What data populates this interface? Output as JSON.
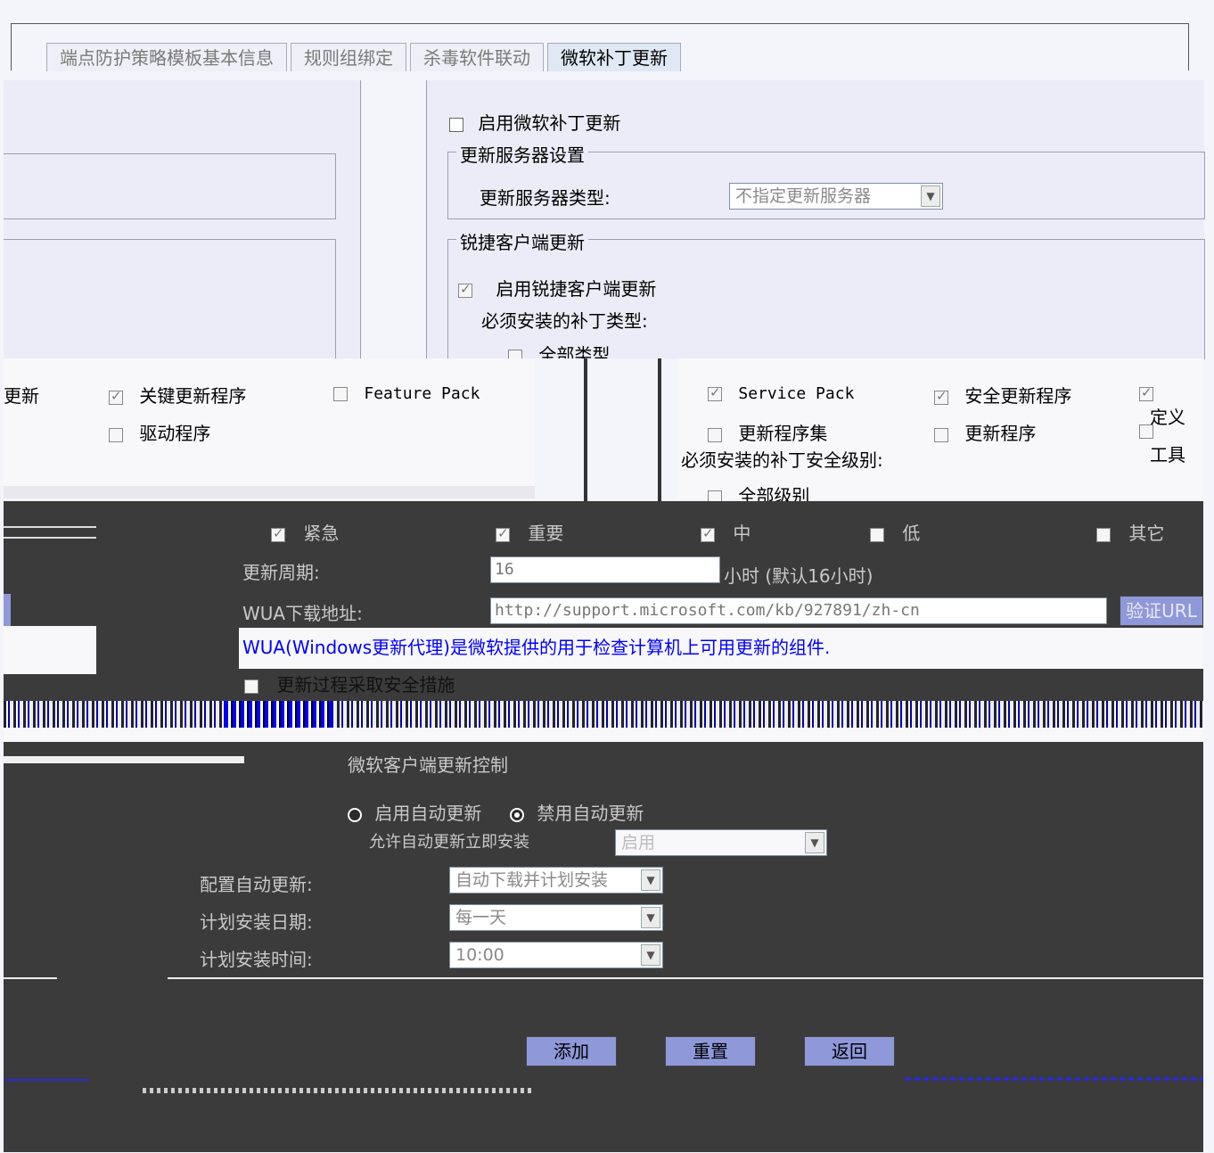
{
  "tabs": [
    {
      "label": "端点防护策略模板基本信息",
      "active": false
    },
    {
      "label": "规则组绑定",
      "active": false
    },
    {
      "label": "杀毒软件联动",
      "active": false
    },
    {
      "label": "微软补丁更新",
      "active": true
    }
  ],
  "enable_ms_patch": {
    "label": "启用微软补丁更新",
    "checked": false
  },
  "server_group": {
    "legend": "更新服务器设置",
    "type_label": "更新服务器类型:",
    "type_value": "不指定更新服务器"
  },
  "ruijie_group": {
    "legend": "锐捷客户端更新",
    "enable_label": "启用锐捷客户端更新",
    "enable_checked": true,
    "patch_types_label": "必须安装的补丁类型:",
    "all_types_label": "全部类型",
    "left_types": [
      {
        "label": "更新",
        "checked": false
      },
      {
        "label": "关键更新程序",
        "checked": true
      },
      {
        "label": "Feature Pack",
        "checked": false
      },
      {
        "label": "驱动程序",
        "checked": false
      }
    ],
    "right_types": [
      {
        "label": "Service Pack",
        "checked": true
      },
      {
        "label": "安全更新程序",
        "checked": true
      },
      {
        "label": "定义",
        "checked": true
      },
      {
        "label": "更新程序集",
        "checked": false
      },
      {
        "label": "更新程序",
        "checked": false
      },
      {
        "label": "工具",
        "checked": false
      }
    ],
    "levels_label": "必须安装的补丁安全级别:",
    "all_levels_label": "全部级别",
    "levels": [
      {
        "label": "紧急",
        "checked": true
      },
      {
        "label": "重要",
        "checked": true
      },
      {
        "label": "中",
        "checked": true
      },
      {
        "label": "低",
        "checked": false
      },
      {
        "label": "其它",
        "checked": false
      }
    ],
    "period_label": "更新周期:",
    "period_value": "16",
    "period_hint": "小时 (默认16小时)",
    "wua_label": "WUA下载地址:",
    "wua_value": "http://support.microsoft.com/kb/927891/zh-cn",
    "verify_label": "验证URL",
    "wua_note": "WUA(Windows更新代理)是微软提供的用于检查计算机上可用更新的组件.",
    "safety_label": "更新过程采取安全措施",
    "safety_checked": false
  },
  "ms_client_group": {
    "legend": "微软客户端更新控制",
    "enable_radio": "启用自动更新",
    "disable_radio": "禁用自动更新",
    "selected": "disable",
    "allow_label": "允许自动更新立即安装",
    "allow_value": "启用",
    "config_label": "配置自动更新:",
    "config_value": "自动下载并计划安装",
    "date_label": "计划安装日期:",
    "date_value": "每一天",
    "time_label": "计划安装时间:",
    "time_value": "10:00"
  },
  "buttons": {
    "add": "添加",
    "reset": "重置",
    "back": "返回"
  },
  "colors": {
    "button": "#8f98d8",
    "dark": "#3b3b3b",
    "panel": "#ececf8",
    "blue": "#0000ff"
  }
}
